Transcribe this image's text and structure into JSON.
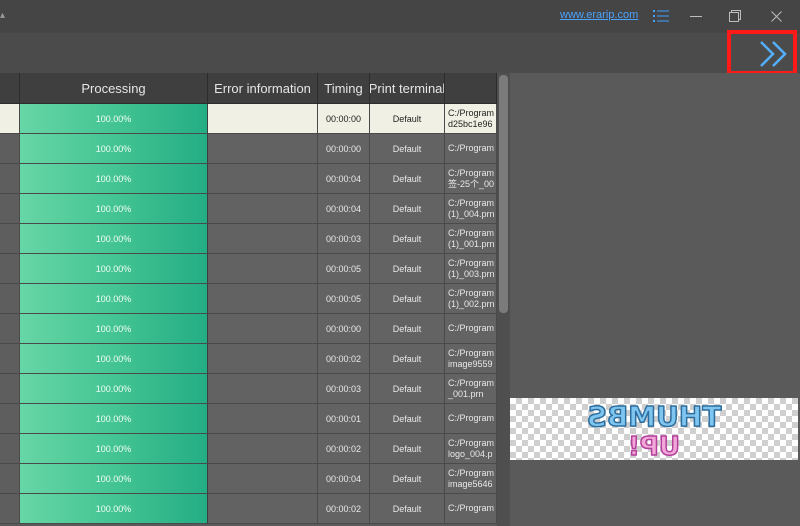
{
  "titlebar": {
    "site_link": "www.erarip.com"
  },
  "icons": {
    "menu": "menu-icon",
    "minimize": "minimize-icon",
    "restore": "restore-icon",
    "close": "close-icon",
    "expand": "double-chevron-right-icon"
  },
  "colors": {
    "accent_green": "#2fb589",
    "highlight_red": "#ff1a1a",
    "link_blue": "#4aa3ff"
  },
  "table": {
    "headers": {
      "processing": "Processing",
      "error": "Error information",
      "timing": "Timing",
      "terminal": "Print terminal"
    },
    "rows": [
      {
        "processing": "100.00%",
        "error": "",
        "timing": "00:00:00",
        "terminal": "Default",
        "path": "C:/Program\nd25bc1e96"
      },
      {
        "processing": "100.00%",
        "error": "",
        "timing": "00:00:00",
        "terminal": "Default",
        "path": "C:/Program"
      },
      {
        "processing": "100.00%",
        "error": "",
        "timing": "00:00:04",
        "terminal": "Default",
        "path": "C:/Program\n签-25个_00"
      },
      {
        "processing": "100.00%",
        "error": "",
        "timing": "00:00:04",
        "terminal": "Default",
        "path": "C:/Program\n(1)_004.prn"
      },
      {
        "processing": "100.00%",
        "error": "",
        "timing": "00:00:03",
        "terminal": "Default",
        "path": "C:/Program\n(1)_001.prn"
      },
      {
        "processing": "100.00%",
        "error": "",
        "timing": "00:00:05",
        "terminal": "Default",
        "path": "C:/Program\n(1)_003.prn"
      },
      {
        "processing": "100.00%",
        "error": "",
        "timing": "00:00:05",
        "terminal": "Default",
        "path": "C:/Program\n(1)_002.prn"
      },
      {
        "processing": "100.00%",
        "error": "",
        "timing": "00:00:00",
        "terminal": "Default",
        "path": "C:/Program"
      },
      {
        "processing": "100.00%",
        "error": "",
        "timing": "00:00:02",
        "terminal": "Default",
        "path": "C:/Program\nimage9559"
      },
      {
        "processing": "100.00%",
        "error": "",
        "timing": "00:00:03",
        "terminal": "Default",
        "path": "C:/Program\n_001.prn"
      },
      {
        "processing": "100.00%",
        "error": "",
        "timing": "00:00:01",
        "terminal": "Default",
        "path": "C:/Program"
      },
      {
        "processing": "100.00%",
        "error": "",
        "timing": "00:00:02",
        "terminal": "Default",
        "path": "C:/Program\nlogo_004.p"
      },
      {
        "processing": "100.00%",
        "error": "",
        "timing": "00:00:04",
        "terminal": "Default",
        "path": "C:/Program\nimage5646"
      },
      {
        "processing": "100.00%",
        "error": "",
        "timing": "00:00:02",
        "terminal": "Default",
        "path": "C:/Program"
      }
    ]
  },
  "preview": {
    "line1": "THUMBS",
    "line2": "UP!"
  }
}
